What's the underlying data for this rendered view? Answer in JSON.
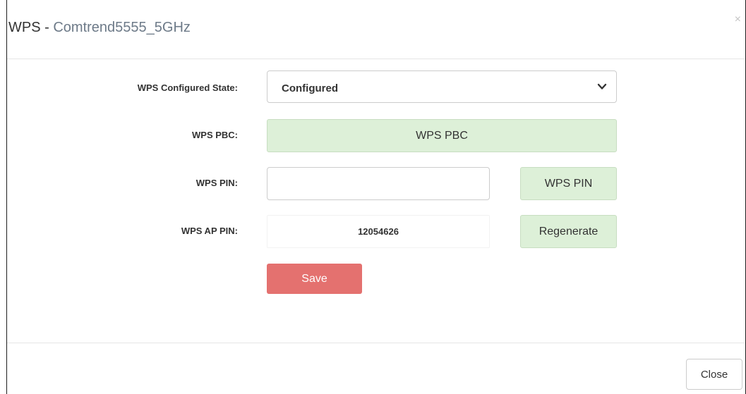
{
  "header": {
    "title_prefix": "WPS - ",
    "ssid": "Comtrend5555_5GHz",
    "close_glyph": "×"
  },
  "form": {
    "configured_state": {
      "label": "WPS Configured State:",
      "selected": "Configured"
    },
    "pbc": {
      "label": "WPS PBC:",
      "button": "WPS PBC"
    },
    "pin": {
      "label": "WPS PIN:",
      "value": "",
      "button": "WPS PIN"
    },
    "ap_pin": {
      "label": "WPS AP PIN:",
      "value": "12054626",
      "button": "Regenerate"
    },
    "save_label": "Save"
  },
  "footer": {
    "close_label": "Close"
  },
  "colors": {
    "green_button": "#ddf0d8",
    "save_button": "#e4716f",
    "ssid_text": "#6d7a88"
  },
  "icons": {
    "close": "close-icon",
    "select_arrow": "chevron-down-icon"
  }
}
